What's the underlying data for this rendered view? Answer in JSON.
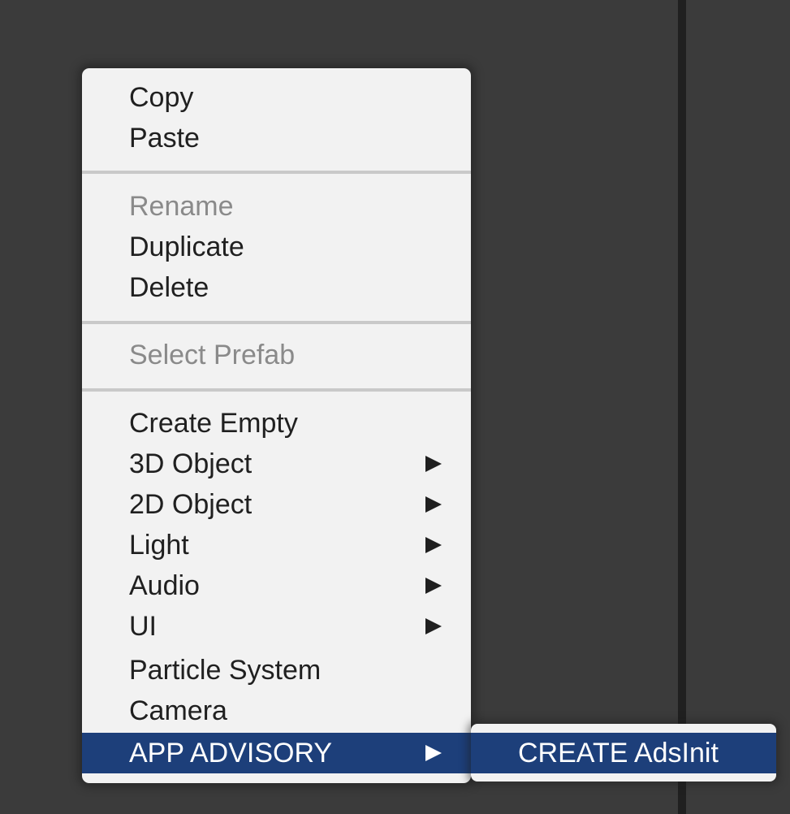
{
  "context_menu": {
    "groups": [
      {
        "items": [
          {
            "label": "Copy",
            "enabled": true,
            "has_submenu": false
          },
          {
            "label": "Paste",
            "enabled": true,
            "has_submenu": false
          }
        ]
      },
      {
        "items": [
          {
            "label": "Rename",
            "enabled": false,
            "has_submenu": false
          },
          {
            "label": "Duplicate",
            "enabled": true,
            "has_submenu": false
          },
          {
            "label": "Delete",
            "enabled": true,
            "has_submenu": false
          }
        ]
      },
      {
        "items": [
          {
            "label": "Select Prefab",
            "enabled": false,
            "has_submenu": false
          }
        ]
      },
      {
        "items": [
          {
            "label": "Create Empty",
            "enabled": true,
            "has_submenu": false
          },
          {
            "label": "3D Object",
            "enabled": true,
            "has_submenu": true
          },
          {
            "label": "2D Object",
            "enabled": true,
            "has_submenu": true
          },
          {
            "label": "Light",
            "enabled": true,
            "has_submenu": true
          },
          {
            "label": "Audio",
            "enabled": true,
            "has_submenu": true
          },
          {
            "label": "UI",
            "enabled": true,
            "has_submenu": true
          },
          {
            "label": "Particle System",
            "enabled": true,
            "has_submenu": false
          },
          {
            "label": "Camera",
            "enabled": true,
            "has_submenu": false
          },
          {
            "label": "APP ADVISORY",
            "enabled": true,
            "has_submenu": true,
            "highlighted": true
          }
        ]
      }
    ]
  },
  "submenu": {
    "parent": "APP ADVISORY",
    "items": [
      {
        "label": "CREATE AdsInit",
        "highlighted": true
      }
    ]
  },
  "icons": {
    "submenu_arrow": "submenu-arrow-icon"
  },
  "colors": {
    "highlight": "#1d3f7a",
    "menu_background": "#f2f2f2",
    "disabled_text": "#8a8a8a",
    "panel_background": "#3b3b3b"
  }
}
